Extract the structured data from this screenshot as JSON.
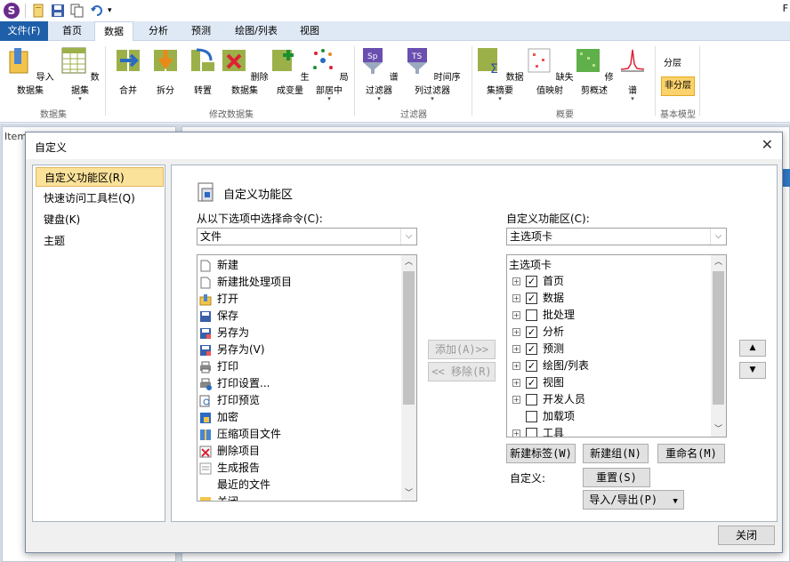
{
  "titlebar": {
    "app_logo": "S",
    "title_fragment": "F"
  },
  "tabs": [
    {
      "label": "文件(F)"
    },
    {
      "label": "首页"
    },
    {
      "label": "数据"
    },
    {
      "label": "分析"
    },
    {
      "label": "预测"
    },
    {
      "label": "绘图/列表"
    },
    {
      "label": "视图"
    }
  ],
  "ribbon": {
    "buttons": [
      {
        "label": "导入数据集"
      },
      {
        "label": "数据集"
      },
      {
        "label": "合并"
      },
      {
        "label": "拆分"
      },
      {
        "label": "转置"
      },
      {
        "label": "删除数据集"
      },
      {
        "label": "生成变量"
      },
      {
        "label": "局部居中"
      },
      {
        "label": "谱过滤器"
      },
      {
        "label": "时间序列过滤器"
      },
      {
        "label": "数据集摘要"
      },
      {
        "label": "缺失值映射"
      },
      {
        "label": "修剪概述"
      },
      {
        "label": "谱"
      }
    ],
    "groups": [
      {
        "label": "数据集"
      },
      {
        "label": "修改数据集"
      },
      {
        "label": "过滤器"
      },
      {
        "label": "概要"
      },
      {
        "label": "基本模型"
      }
    ],
    "layer_label": "分层",
    "nonlayer_label": "非分层"
  },
  "background": {
    "item_label": "Item"
  },
  "dialog": {
    "title": "自定义",
    "nav": [
      {
        "label": "自定义功能区(R)"
      },
      {
        "label": "快速访问工具栏(Q)"
      },
      {
        "label": "键盘(K)"
      },
      {
        "label": "主题"
      }
    ],
    "header": "自定义功能区",
    "choose_label": "从以下选项中选择命令(C):",
    "choose_value": "文件",
    "commands": [
      {
        "label": "新建"
      },
      {
        "label": "新建批处理项目"
      },
      {
        "label": "打开"
      },
      {
        "label": "保存"
      },
      {
        "label": "另存为"
      },
      {
        "label": "另存为(V)"
      },
      {
        "label": "打印"
      },
      {
        "label": "打印设置..."
      },
      {
        "label": "打印预览"
      },
      {
        "label": "加密"
      },
      {
        "label": "压缩项目文件"
      },
      {
        "label": "删除项目"
      },
      {
        "label": "生成报告"
      },
      {
        "label": "最近的文件"
      },
      {
        "label": "关闭"
      }
    ],
    "add_button": "添加(A)>>",
    "remove_button": "<< 移除(R)",
    "customize_label": "自定义功能区(C):",
    "customize_value": "主选项卡",
    "tree_header": "主选项卡",
    "tree": [
      {
        "label": "首页",
        "checked": true
      },
      {
        "label": "数据",
        "checked": true
      },
      {
        "label": "批处理",
        "checked": false
      },
      {
        "label": "分析",
        "checked": true
      },
      {
        "label": "预测",
        "checked": true
      },
      {
        "label": "绘图/列表",
        "checked": true
      },
      {
        "label": "视图",
        "checked": true
      },
      {
        "label": "开发人员",
        "checked": false
      },
      {
        "label": "加载项",
        "checked": false
      },
      {
        "label": "工具",
        "checked": false
      }
    ],
    "new_tab_button": "新建标签(W)",
    "new_group_button": "新建组(N)",
    "rename_button": "重命名(M)",
    "custom_label": "自定义:",
    "reset_button": "重置(S)",
    "import_export_button": "导入/导出(P)",
    "close_button": "关闭"
  }
}
